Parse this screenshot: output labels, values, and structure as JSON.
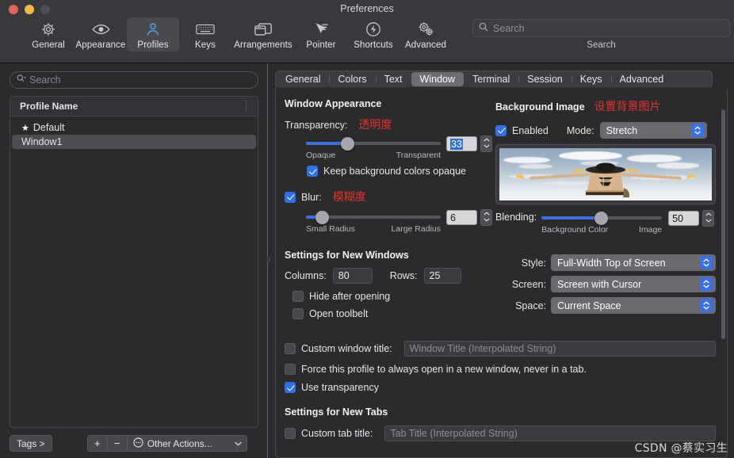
{
  "window": {
    "title": "Preferences",
    "traffic": {
      "close": "close-button",
      "minimize": "minimize-button",
      "zoom": "zoom-button"
    }
  },
  "toolbar": {
    "items": [
      {
        "label": "General",
        "icon": "gear-icon"
      },
      {
        "label": "Appearance",
        "icon": "eye-icon"
      },
      {
        "label": "Profiles",
        "icon": "person-icon",
        "active": true
      },
      {
        "label": "Keys",
        "icon": "keyboard-icon"
      },
      {
        "label": "Arrangements",
        "icon": "windows-icon"
      },
      {
        "label": "Pointer",
        "icon": "cursor-icon"
      },
      {
        "label": "Shortcuts",
        "icon": "bolt-icon"
      },
      {
        "label": "Advanced",
        "icon": "gears-icon"
      }
    ],
    "search": {
      "placeholder": "Search",
      "value": "",
      "caption": "Search",
      "icon": "search-icon"
    }
  },
  "sidebar": {
    "search": {
      "placeholder": "Search",
      "value": "",
      "icon": "search-icon"
    },
    "table": {
      "column_header": "Profile Name",
      "rows": [
        {
          "name": "Default",
          "starred": true,
          "star_glyph": "★",
          "selected": false
        },
        {
          "name": "Window1",
          "starred": false,
          "selected": true
        }
      ]
    },
    "footer": {
      "tags_label": "Tags >",
      "add_label": "+",
      "remove_label": "−",
      "other_actions_label": "Other Actions...",
      "other_actions_icon": "ellipsis-circle-icon",
      "caret_glyph": "⌄"
    }
  },
  "tabs": [
    {
      "label": "General",
      "active": false
    },
    {
      "label": "Colors",
      "active": false
    },
    {
      "label": "Text",
      "active": false
    },
    {
      "label": "Window",
      "active": true
    },
    {
      "label": "Terminal",
      "active": false
    },
    {
      "label": "Session",
      "active": false
    },
    {
      "label": "Keys",
      "active": false
    },
    {
      "label": "Advanced",
      "active": false
    }
  ],
  "window_appearance": {
    "section_title": "Window Appearance",
    "transparency": {
      "label": "Transparency:",
      "annotation": "透明度",
      "value": "33",
      "min_label": "Opaque",
      "max_label": "Transparent",
      "percent": 33,
      "selected": true
    },
    "keep_bg_opaque": {
      "label": "Keep background colors opaque",
      "checked": true
    },
    "blur": {
      "label": "Blur:",
      "annotation": "模糊度",
      "checked": true,
      "value": "6",
      "min_label": "Small Radius",
      "max_label": "Large Radius",
      "percent": 13
    }
  },
  "new_windows": {
    "section_title": "Settings for New Windows",
    "columns": {
      "label": "Columns:",
      "value": "80"
    },
    "rows": {
      "label": "Rows:",
      "value": "25"
    },
    "hide_after_opening": {
      "label": "Hide after opening",
      "checked": false
    },
    "open_toolbelt": {
      "label": "Open toolbelt",
      "checked": false
    },
    "custom_window_title": {
      "label": "Custom window title:",
      "checked": false,
      "placeholder": "Window Title (Interpolated String)",
      "value": ""
    },
    "force_new_window": {
      "label": "Force this profile to always open in a new window, never in a tab.",
      "checked": false
    },
    "use_transparency": {
      "label": "Use transparency",
      "checked": true
    }
  },
  "new_tabs": {
    "section_title": "Settings for New Tabs",
    "custom_tab_title": {
      "label": "Custom tab title:",
      "checked": false,
      "placeholder": "Tab Title (Interpolated String)",
      "value": ""
    }
  },
  "background_image": {
    "section_title": "Background Image",
    "annotation": "设置背景图片",
    "enabled": {
      "label": "Enabled",
      "checked": true
    },
    "mode": {
      "label": "Mode:",
      "value": "Stretch"
    },
    "preview_alt": "background-image-preview",
    "blending": {
      "label": "Blending:",
      "value": "50",
      "min_label": "Background Color",
      "max_label": "Image",
      "percent": 50
    }
  },
  "window_placement": {
    "style": {
      "label": "Style:",
      "value": "Full-Width Top of Screen"
    },
    "screen": {
      "label": "Screen:",
      "value": "Screen with Cursor"
    },
    "space": {
      "label": "Space:",
      "value": "Current Space"
    }
  },
  "watermark": "CSDN @蔡实习生",
  "colors": {
    "accent_blue": "#3b70e2",
    "annotation_red": "#e2342b",
    "toolbar_bg": "#39383c",
    "panel_bg": "#2b2b2e",
    "active_tab": "#6e6d73"
  }
}
